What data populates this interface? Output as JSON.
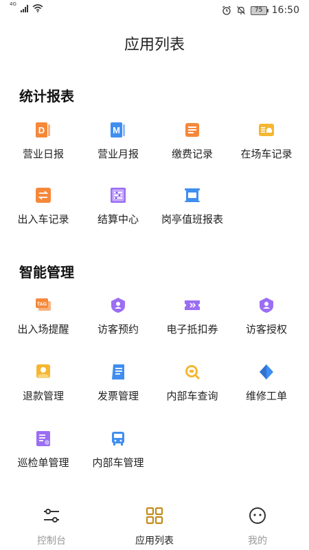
{
  "status_bar": {
    "network": "4G",
    "time": "16:50",
    "battery": "75"
  },
  "page_title": "应用列表",
  "sections": [
    {
      "title": "统计报表",
      "items": [
        {
          "label": "营业日报",
          "icon": "daily-report-icon",
          "glyph": "D"
        },
        {
          "label": "营业月报",
          "icon": "monthly-report-icon",
          "glyph": "M"
        },
        {
          "label": "缴费记录",
          "icon": "payment-record-icon"
        },
        {
          "label": "在场车记录",
          "icon": "parked-car-record-icon"
        },
        {
          "label": "出入车记录",
          "icon": "entry-exit-record-icon"
        },
        {
          "label": "结算中心",
          "icon": "settlement-icon"
        },
        {
          "label": "岗亭值班报表",
          "icon": "booth-duty-report-icon"
        }
      ]
    },
    {
      "title": "智能管理",
      "items": [
        {
          "label": "出入场提醒",
          "icon": "tag-reminder-icon",
          "glyph": "TAG"
        },
        {
          "label": "访客预约",
          "icon": "visitor-appointment-icon"
        },
        {
          "label": "电子抵扣券",
          "icon": "coupon-icon"
        },
        {
          "label": "访客授权",
          "icon": "visitor-authorize-icon"
        },
        {
          "label": "退款管理",
          "icon": "refund-icon"
        },
        {
          "label": "发票管理",
          "icon": "invoice-icon"
        },
        {
          "label": "内部车查询",
          "icon": "internal-car-search-icon"
        },
        {
          "label": "维修工单",
          "icon": "repair-order-icon"
        },
        {
          "label": "巡检单管理",
          "icon": "inspection-icon"
        },
        {
          "label": "内部车管理",
          "icon": "internal-car-manage-icon"
        }
      ]
    }
  ],
  "bottom_nav": [
    {
      "label": "控制台",
      "icon": "sliders-icon",
      "active": false
    },
    {
      "label": "应用列表",
      "icon": "grid-icon",
      "active": true
    },
    {
      "label": "我的",
      "icon": "smiley-icon",
      "active": false
    }
  ],
  "colors": {
    "orange": "#f5883a",
    "blue": "#3f8ef0",
    "purple": "#9b6ef3",
    "yellow": "#f6b631",
    "active_nav": "#c28a18"
  }
}
